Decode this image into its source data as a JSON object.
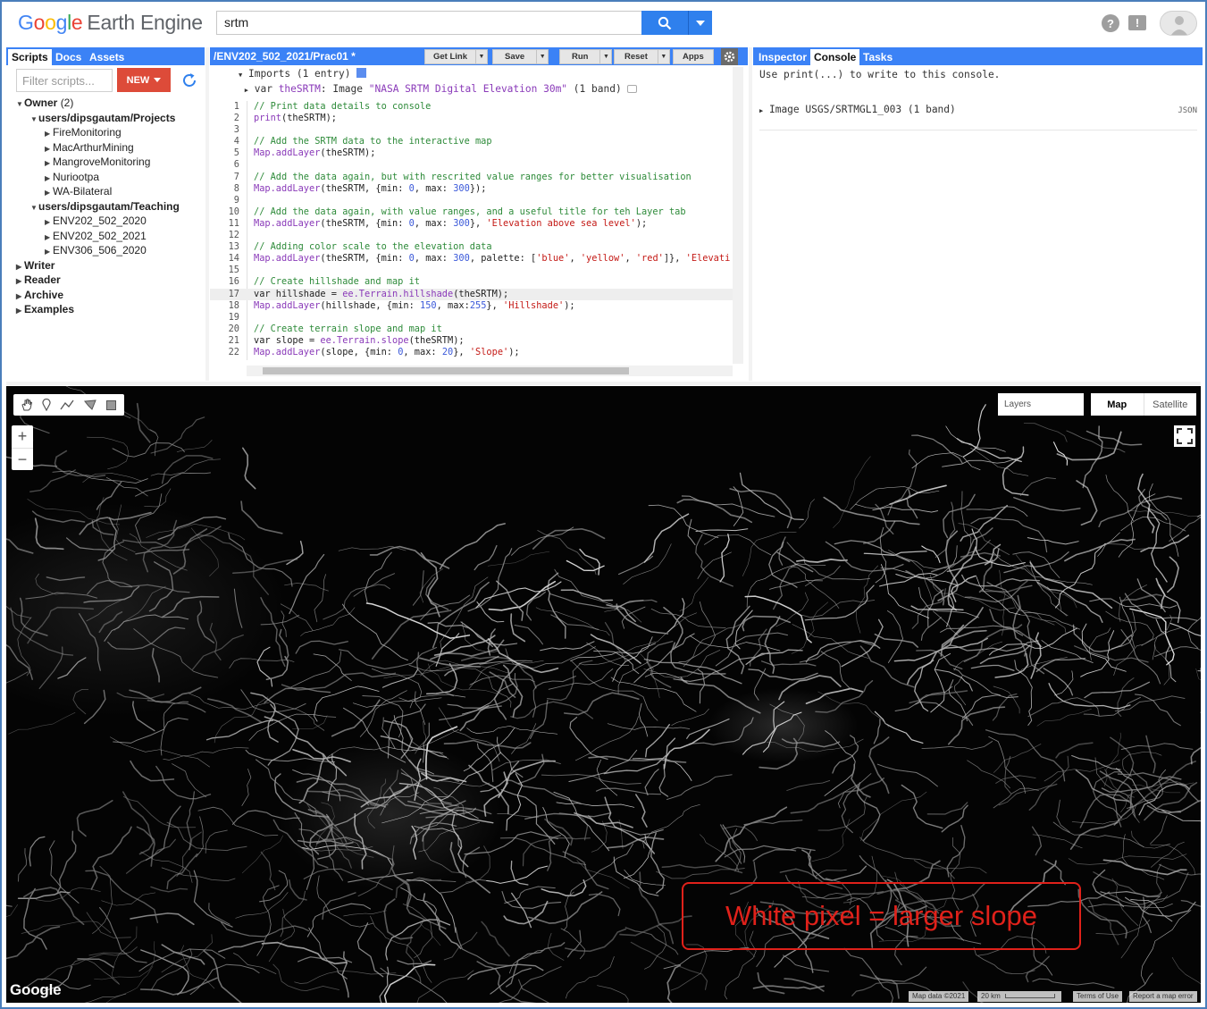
{
  "header": {
    "logo_google": [
      "G",
      "o",
      "o",
      "g",
      "l",
      "e"
    ],
    "logo_product": "Earth Engine",
    "search_value": "srtm",
    "help_icon": "help-circle-icon",
    "feedback_icon": "feedback-icon",
    "account_icon": "account-avatar-icon"
  },
  "left_panel": {
    "tabs": [
      "Scripts",
      "Docs",
      "Assets"
    ],
    "active_tab": "Scripts",
    "filter_placeholder": "Filter scripts...",
    "new_label": "NEW",
    "tree": [
      {
        "label": "Owner",
        "count": "(2)",
        "bold": true,
        "open": true,
        "indent": 0
      },
      {
        "label": "users/dipsgautam/Projects",
        "bold": true,
        "open": true,
        "indent": 1
      },
      {
        "label": "FireMonitoring",
        "indent": 2
      },
      {
        "label": "MacArthurMining",
        "indent": 2
      },
      {
        "label": "MangroveMonitoring",
        "indent": 2
      },
      {
        "label": "Nuriootpa",
        "indent": 2
      },
      {
        "label": "WA-Bilateral",
        "indent": 2
      },
      {
        "label": "users/dipsgautam/Teaching",
        "bold": true,
        "open": true,
        "indent": 1
      },
      {
        "label": "ENV202_502_2020",
        "indent": 2
      },
      {
        "label": "ENV202_502_2021",
        "indent": 2
      },
      {
        "label": "ENV306_506_2020",
        "indent": 2
      },
      {
        "label": "Writer",
        "bold": true,
        "indent": 0
      },
      {
        "label": "Reader",
        "bold": true,
        "indent": 0
      },
      {
        "label": "Archive",
        "bold": true,
        "indent": 0
      },
      {
        "label": "Examples",
        "bold": true,
        "indent": 0
      }
    ]
  },
  "editor": {
    "title": "/ENV202_502_2021/Prac01 *",
    "buttons": [
      {
        "label": "Get Link",
        "dropdown": true
      },
      {
        "label": "Save",
        "dropdown": true
      },
      {
        "label": "Run",
        "dropdown": true
      },
      {
        "label": "Reset",
        "dropdown": true
      },
      {
        "label": "Apps",
        "dropdown": false
      }
    ],
    "imports_header": "Imports (1 entry)",
    "import_line": {
      "keyword": "var",
      "name": "theSRTM",
      "type": "Image",
      "desc": "\"NASA SRTM Digital Elevation 30m\"",
      "bands": "(1 band)"
    },
    "current_line": 17,
    "lines": [
      [
        {
          "t": "// Print data details to console",
          "c": "cm"
        }
      ],
      [
        {
          "t": "print",
          "c": "fn"
        },
        {
          "t": "(theSRTM);"
        }
      ],
      [],
      [
        {
          "t": "// Add the SRTM data to the interactive map",
          "c": "cm"
        }
      ],
      [
        {
          "t": "Map",
          "c": "fn"
        },
        {
          "t": ".addLayer",
          "c": "fn"
        },
        {
          "t": "(theSRTM);"
        }
      ],
      [],
      [
        {
          "t": "// Add the data again, but with rescrited value ranges for better visualisation",
          "c": "cm"
        }
      ],
      [
        {
          "t": "Map",
          "c": "fn"
        },
        {
          "t": ".addLayer",
          "c": "fn"
        },
        {
          "t": "(theSRTM, {min: "
        },
        {
          "t": "0",
          "c": "nm"
        },
        {
          "t": ", max: "
        },
        {
          "t": "300",
          "c": "nm"
        },
        {
          "t": "});"
        }
      ],
      [],
      [
        {
          "t": "// Add the data again, with value ranges, and a useful title for teh Layer tab",
          "c": "cm"
        }
      ],
      [
        {
          "t": "Map",
          "c": "fn"
        },
        {
          "t": ".addLayer",
          "c": "fn"
        },
        {
          "t": "(theSRTM, {min: "
        },
        {
          "t": "0",
          "c": "nm"
        },
        {
          "t": ", max: "
        },
        {
          "t": "300",
          "c": "nm"
        },
        {
          "t": "}, "
        },
        {
          "t": "'Elevation above sea level'",
          "c": "st"
        },
        {
          "t": ");"
        }
      ],
      [],
      [
        {
          "t": "// Adding color scale to the elevation data",
          "c": "cm"
        }
      ],
      [
        {
          "t": "Map",
          "c": "fn"
        },
        {
          "t": ".addLayer",
          "c": "fn"
        },
        {
          "t": "(theSRTM, {min: "
        },
        {
          "t": "0",
          "c": "nm"
        },
        {
          "t": ", max: "
        },
        {
          "t": "300",
          "c": "nm"
        },
        {
          "t": ", palette: ["
        },
        {
          "t": "'blue'",
          "c": "st"
        },
        {
          "t": ", "
        },
        {
          "t": "'yellow'",
          "c": "st"
        },
        {
          "t": ", "
        },
        {
          "t": "'red'",
          "c": "st"
        },
        {
          "t": "]}, "
        },
        {
          "t": "'Elevati",
          "c": "st"
        }
      ],
      [],
      [
        {
          "t": "// Create hillshade and map it",
          "c": "cm"
        }
      ],
      [
        {
          "t": "var hillshade = "
        },
        {
          "t": "ee.Terrain.hillshade",
          "c": "fn"
        },
        {
          "t": "(theSRTM);"
        }
      ],
      [
        {
          "t": "Map",
          "c": "fn"
        },
        {
          "t": ".addLayer",
          "c": "fn"
        },
        {
          "t": "(hillshade, {min: "
        },
        {
          "t": "150",
          "c": "nm"
        },
        {
          "t": ", max:"
        },
        {
          "t": "255",
          "c": "nm"
        },
        {
          "t": "}, "
        },
        {
          "t": "'Hillshade'",
          "c": "st"
        },
        {
          "t": ");"
        }
      ],
      [],
      [
        {
          "t": "// Create terrain slope and map it",
          "c": "cm"
        }
      ],
      [
        {
          "t": "var slope = "
        },
        {
          "t": "ee.Terrain.slope",
          "c": "fn"
        },
        {
          "t": "(theSRTM);"
        }
      ],
      [
        {
          "t": "Map",
          "c": "fn"
        },
        {
          "t": ".addLayer",
          "c": "fn"
        },
        {
          "t": "(slope, {min: "
        },
        {
          "t": "0",
          "c": "nm"
        },
        {
          "t": ", max: "
        },
        {
          "t": "20",
          "c": "nm"
        },
        {
          "t": "}, "
        },
        {
          "t": "'Slope'",
          "c": "st"
        },
        {
          "t": ");"
        }
      ]
    ]
  },
  "right_panel": {
    "tabs": [
      "Inspector",
      "Console",
      "Tasks"
    ],
    "active_tab": "Console",
    "hint": "Use print(...) to write to this console.",
    "entry": "Image USGS/SRTMGL1_003 (1 band)",
    "entry_format": "JSON"
  },
  "map": {
    "tools": [
      "hand-icon",
      "marker-icon",
      "line-icon",
      "polygon-icon",
      "rectangle-icon"
    ],
    "zoom_in": "+",
    "zoom_out": "−",
    "layers_label": "Layers",
    "map_types": [
      "Map",
      "Satellite"
    ],
    "selected_map_type": "Map",
    "google_mark": "Google",
    "attribution": {
      "map_data": "Map data ©2021",
      "scale": "20 km",
      "terms": "Terms of Use",
      "report": "Report a map error"
    },
    "annotation": "White pixel = larger slope"
  },
  "colors": {
    "accent_blue": "#3b82f6",
    "search_blue": "#2f80ed",
    "new_red": "#dd4b39",
    "annotation_red": "#e0211a",
    "comment_green": "#2e8b3a"
  }
}
